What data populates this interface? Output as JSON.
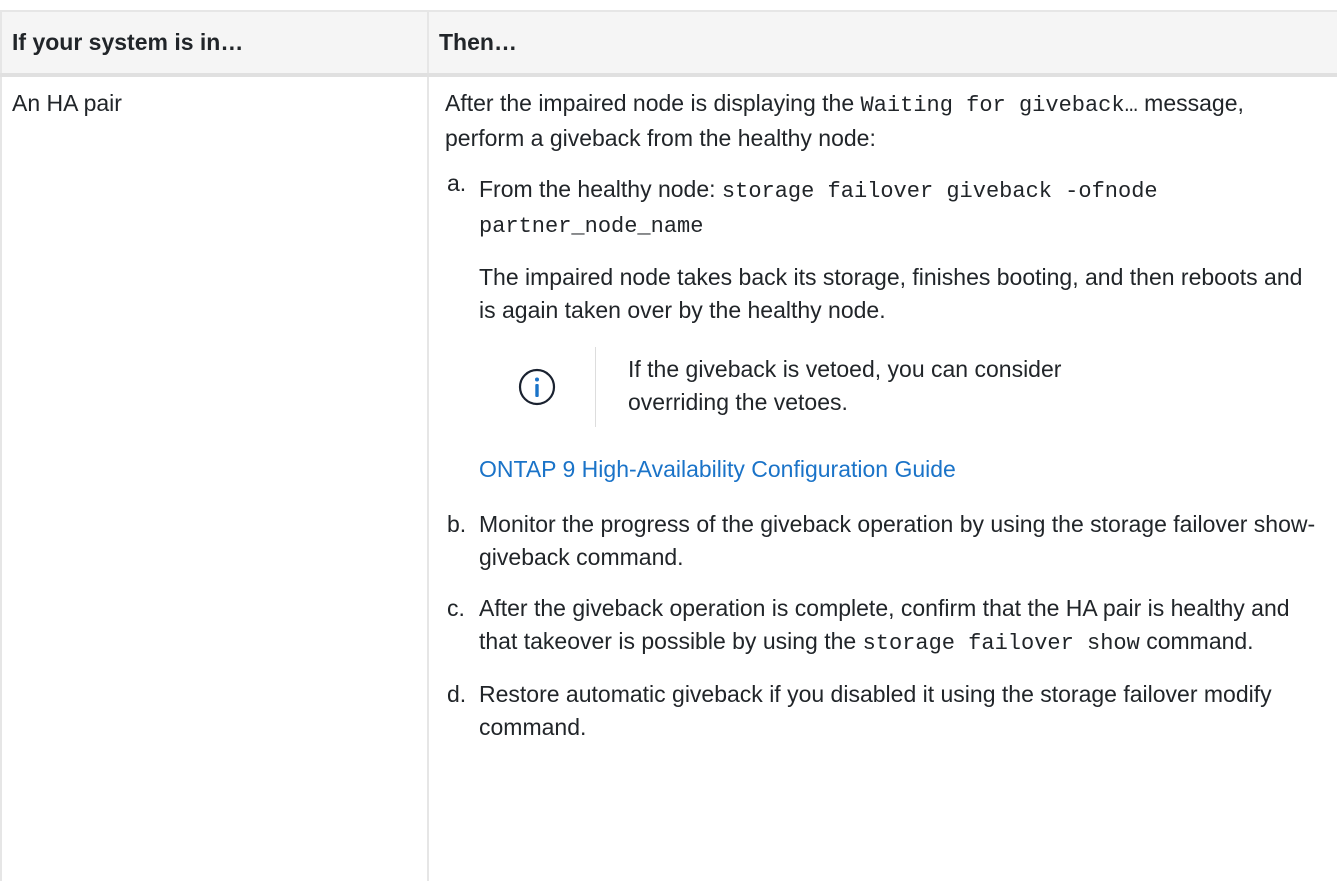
{
  "table": {
    "headers": [
      "If your system is in…",
      "Then…"
    ],
    "row": {
      "condition": "An HA pair",
      "intro_before": "After the impaired node is displaying the ",
      "intro_code": "Waiting for giveback…",
      "intro_after": " message, perform a giveback from the healthy node:",
      "steps": {
        "a": {
          "marker": "a.",
          "text": "From the healthy node: ",
          "code": "storage failover giveback -ofnode partner_node_name",
          "para": "The impaired node takes back its storage, finishes booting, and then reboots and is again taken over by the healthy node.",
          "note": "If the giveback is vetoed, you can consider overriding the vetoes.",
          "note_icon": "info-icon",
          "link": "ONTAP 9 High-Availability Configuration Guide"
        },
        "b": {
          "marker": "b.",
          "text": "Monitor the progress of the giveback operation by using the storage failover show-giveback command."
        },
        "c": {
          "marker": "c.",
          "text_before": "After the giveback operation is complete, confirm that the HA pair is healthy and that takeover is possible by using the ",
          "code": "storage failover show",
          "text_after": " command."
        },
        "d": {
          "marker": "d.",
          "text": "Restore automatic giveback if you disabled it using the storage failover modify command."
        }
      }
    }
  },
  "colors": {
    "link": "#1a73c8",
    "info_icon": "#1a73c8",
    "header_bg": "#f5f5f5",
    "border": "#e6e6e6"
  }
}
